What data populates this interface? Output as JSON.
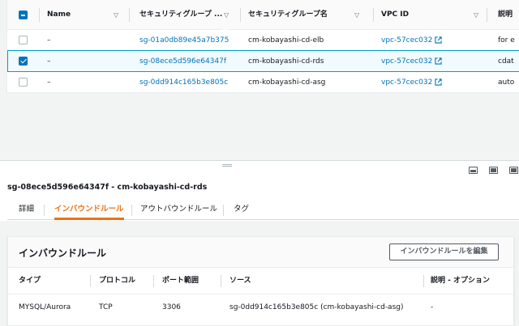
{
  "security_groups": {
    "columns": [
      "Name",
      "セキュリティグループ ...",
      "セキュリティグループ名",
      "VPC ID",
      "説明"
    ],
    "rows": [
      {
        "name": "–",
        "group_id": "sg-01a0db89e45a7b375",
        "group_name": "cm-kobayashi-cd-elb",
        "vpc_id": "vpc-57cec032",
        "description": "for e",
        "selected": false
      },
      {
        "name": "–",
        "group_id": "sg-08ece5d596e64347f",
        "group_name": "cm-kobayashi-cd-rds",
        "vpc_id": "vpc-57cec032",
        "description": "cdat",
        "selected": true
      },
      {
        "name": "–",
        "group_id": "sg-0dd914c165b3e805c",
        "group_name": "cm-kobayashi-cd-asg",
        "vpc_id": "vpc-57cec032",
        "description": "auto",
        "selected": false
      }
    ]
  },
  "detail": {
    "title": "sg-08ece5d596e64347f - cm-kobayashi-cd-rds",
    "tabs": [
      {
        "label": "詳細",
        "active": false
      },
      {
        "label": "インバウンドルール",
        "active": true
      },
      {
        "label": "アウトバウンドルール",
        "active": false
      },
      {
        "label": "タグ",
        "active": false
      }
    ]
  },
  "inbound": {
    "title": "インバウンドルール",
    "edit_button": "インバウンドルールを編集",
    "columns": [
      "タイプ",
      "プロトコル",
      "ポート範囲",
      "ソース",
      "説明 - オプション"
    ],
    "rows": [
      {
        "type": "MYSQL/Aurora",
        "protocol": "TCP",
        "port_range": "3306",
        "source": "sg-0dd914c165b3e805c (cm-kobayashi-cd-asg)",
        "description": "-"
      }
    ]
  },
  "colors": {
    "link": "#0073bb",
    "accent": "#ec7211",
    "selected_border": "#00a1c9"
  }
}
